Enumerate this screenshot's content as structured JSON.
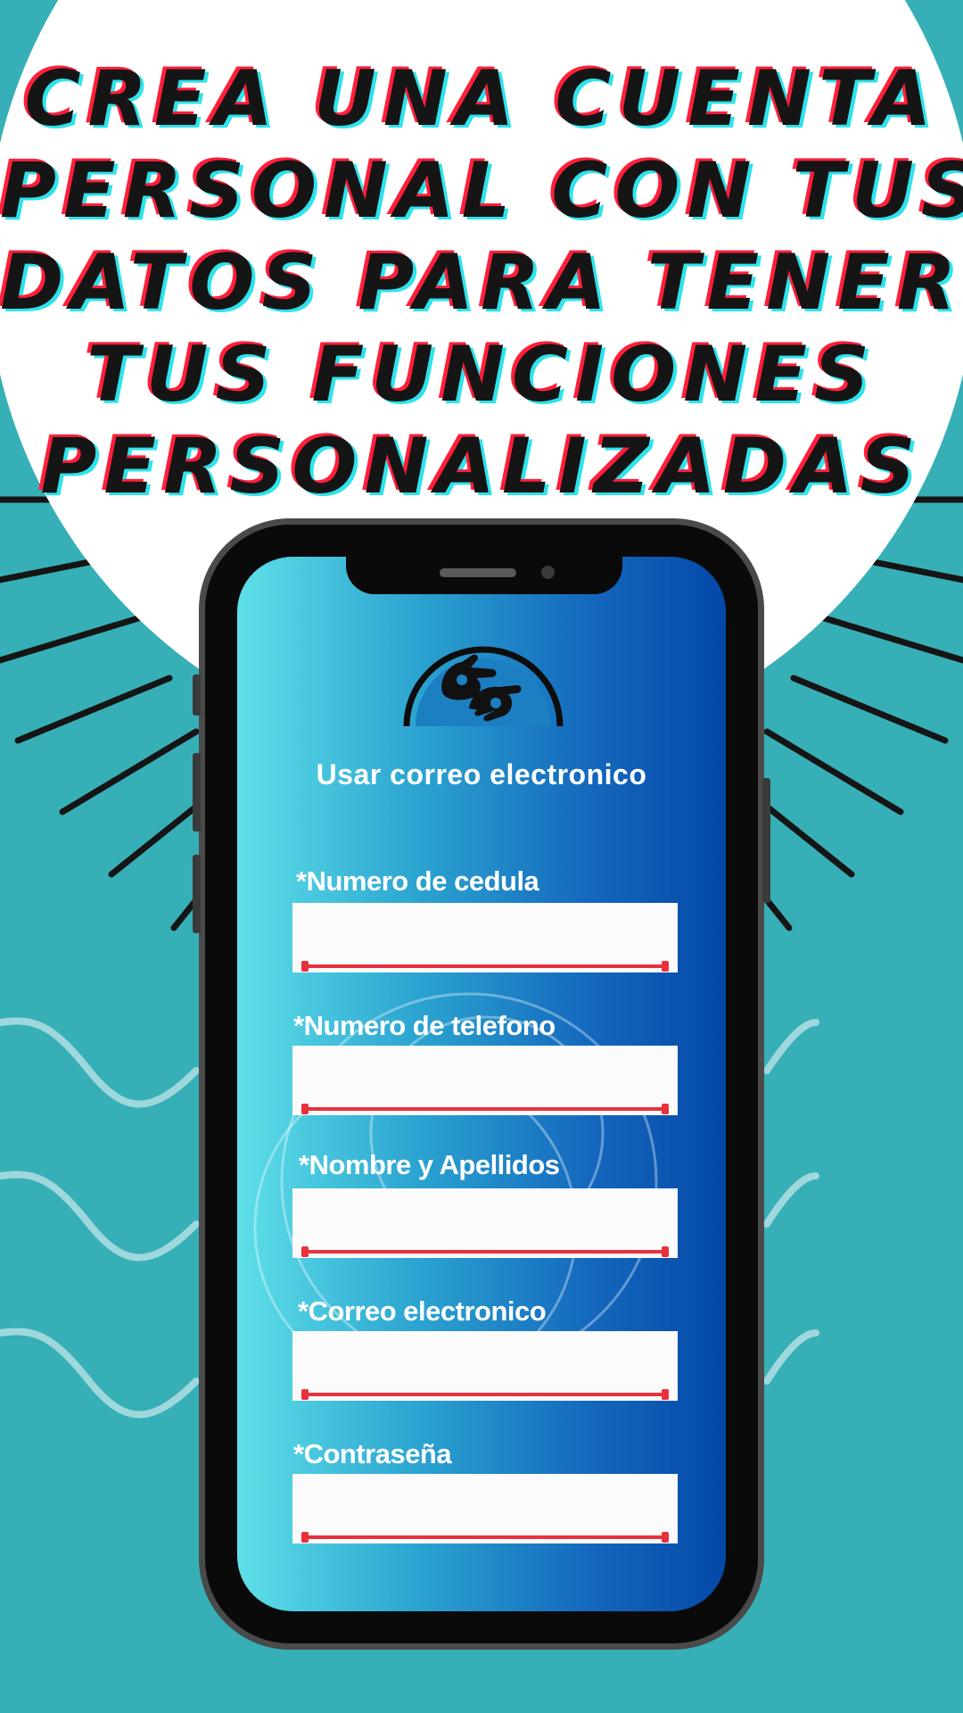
{
  "headline": {
    "lines": [
      "CREA UNA CUENTA",
      "PERSONAL CON TUS",
      "DATOS  PARA TENER",
      "TUS FUNCIONES",
      "PERSONALIZADAS"
    ]
  },
  "app": {
    "logo_icon": "sign-language-hands-icon",
    "use_email_label": "Usar correo electronico"
  },
  "form": {
    "fields": [
      {
        "label": "*Numero de cedula",
        "value": ""
      },
      {
        "label": "*Numero de telefono",
        "value": ""
      },
      {
        "label": "*Nombre y Apellidos",
        "value": ""
      },
      {
        "label": "*Correo electronico",
        "value": ""
      },
      {
        "label": "*Contraseña",
        "value": ""
      }
    ]
  },
  "colors": {
    "background": "#36b0b6",
    "headline_text": "#151515",
    "headline_shadow_red": "#ff1f3a",
    "headline_shadow_cyan": "#2ee3ec",
    "field_underline": "#e8313c",
    "screen_gradient_start": "#5ee0e8",
    "screen_gradient_end": "#0448a8"
  }
}
